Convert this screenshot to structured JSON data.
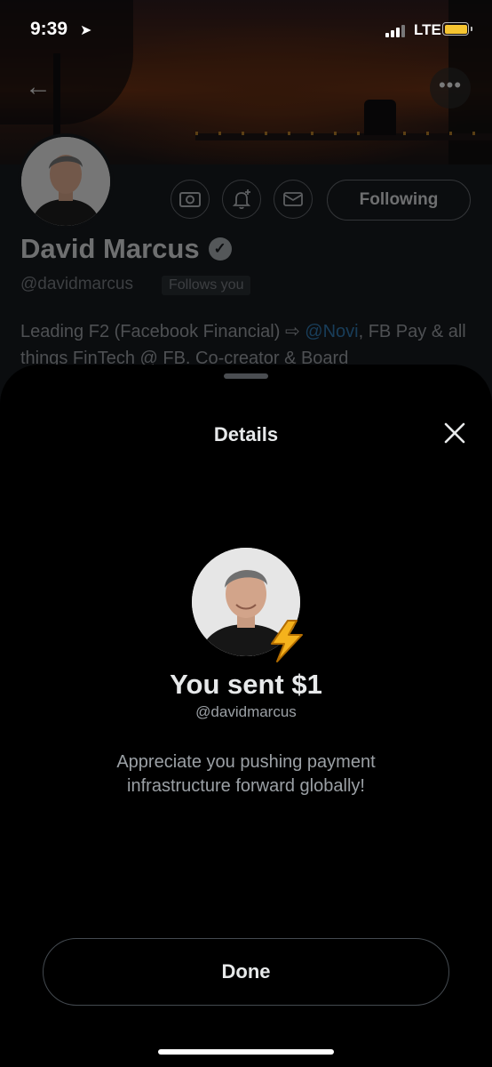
{
  "status_bar": {
    "time": "9:39",
    "network": "LTE",
    "battery_color": "#f6c531",
    "location_icon": "location-arrow-icon"
  },
  "profile": {
    "back_icon": "back-arrow-icon",
    "more_icon": "more-icon",
    "name": "David Marcus",
    "handle": "@davidmarcus",
    "follows_you": "Follows you",
    "follow_button": "Following",
    "action_icons": [
      "tip-jar-icon",
      "notification-bell-add-icon",
      "mail-icon"
    ],
    "bio_parts": {
      "before_mention": "Leading F2 (Facebook Financial) ⇨ ",
      "mention": "@Novi",
      "after_mention": ", FB Pay & all things FinTech @ FB. Co-creator & Board"
    },
    "mention_color": "#1d9bf0"
  },
  "sheet": {
    "title": "Details",
    "close_icon": "close-icon",
    "headline": "You sent $1",
    "handle": "@davidmarcus",
    "message": "Appreciate you pushing payment infrastructure forward globally!",
    "done_label": "Done",
    "badge_icon": "lightning-bolt-icon"
  }
}
